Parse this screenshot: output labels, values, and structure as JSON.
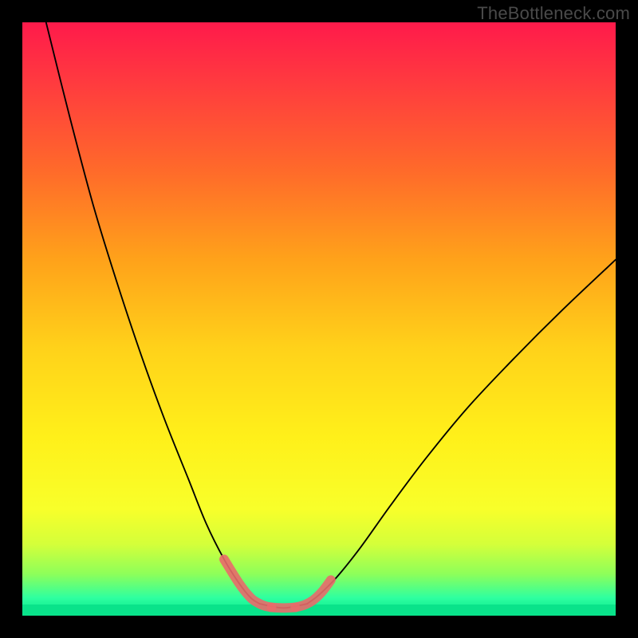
{
  "watermark": "TheBottleneck.com",
  "chart_data": {
    "type": "line",
    "title": "",
    "xlabel": "",
    "ylabel": "",
    "xlim": [
      0,
      100
    ],
    "ylim": [
      0,
      100
    ],
    "grid": false,
    "legend_position": "none",
    "series": [
      {
        "name": "curve-left",
        "stroke": "#000000",
        "x": [
          4,
          8,
          12,
          16,
          20,
          24,
          28,
          31,
          34,
          36.5,
          38.5,
          40
        ],
        "y": [
          100,
          84,
          69,
          56,
          44,
          33,
          23,
          15.5,
          9.5,
          5.5,
          3,
          2
        ]
      },
      {
        "name": "curve-right",
        "stroke": "#000000",
        "x": [
          48,
          50,
          53,
          57,
          62,
          68,
          75,
          83,
          91,
          100
        ],
        "y": [
          2,
          3.5,
          6.5,
          11.5,
          18.5,
          26.5,
          35,
          43.5,
          51.5,
          60
        ]
      },
      {
        "name": "valley-flat",
        "stroke": "#000000",
        "x": [
          40,
          44,
          48
        ],
        "y": [
          2,
          1.3,
          2
        ]
      },
      {
        "name": "highlight-left-overlay",
        "stroke": "#e96a6a",
        "x": [
          34,
          36.5,
          38.5,
          40,
          41,
          42
        ],
        "y": [
          9.5,
          5.5,
          3,
          2,
          1.6,
          1.4
        ]
      },
      {
        "name": "highlight-flat-overlay",
        "stroke": "#e96a6a",
        "x": [
          42,
          44,
          46
        ],
        "y": [
          1.4,
          1.3,
          1.4
        ]
      },
      {
        "name": "highlight-right-overlay",
        "stroke": "#e96a6a",
        "x": [
          46,
          47.5,
          49,
          50.5,
          52
        ],
        "y": [
          1.4,
          1.8,
          2.6,
          4,
          6
        ]
      }
    ],
    "background_gradient": {
      "top": "#ff1a4b",
      "mid": "#fff01a",
      "bottom": "#00e58a"
    }
  }
}
